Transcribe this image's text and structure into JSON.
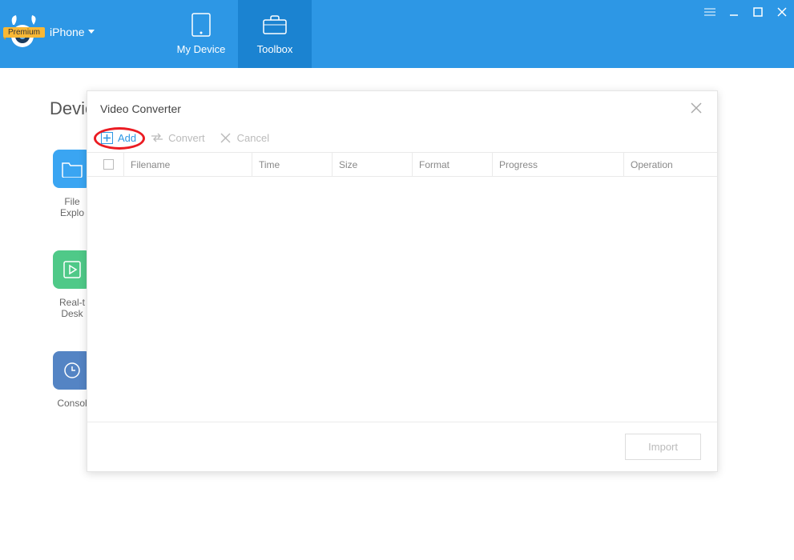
{
  "header": {
    "device_label": "iPhone",
    "premium_badge": "Premium",
    "tabs": {
      "my_device": "My Device",
      "toolbox": "Toolbox"
    }
  },
  "page": {
    "title_partial": "Devic",
    "tiles": {
      "file_explorer_l1": "File",
      "file_explorer_l2": "Explo",
      "realtime_l1": "Real-t",
      "realtime_l2": "Desk",
      "console": "Consol"
    }
  },
  "modal": {
    "title": "Video Converter",
    "toolbar": {
      "add": "Add",
      "convert": "Convert",
      "cancel": "Cancel"
    },
    "columns": {
      "filename": "Filename",
      "time": "Time",
      "size": "Size",
      "format": "Format",
      "progress": "Progress",
      "operation": "Operation"
    },
    "import_btn": "Import"
  }
}
